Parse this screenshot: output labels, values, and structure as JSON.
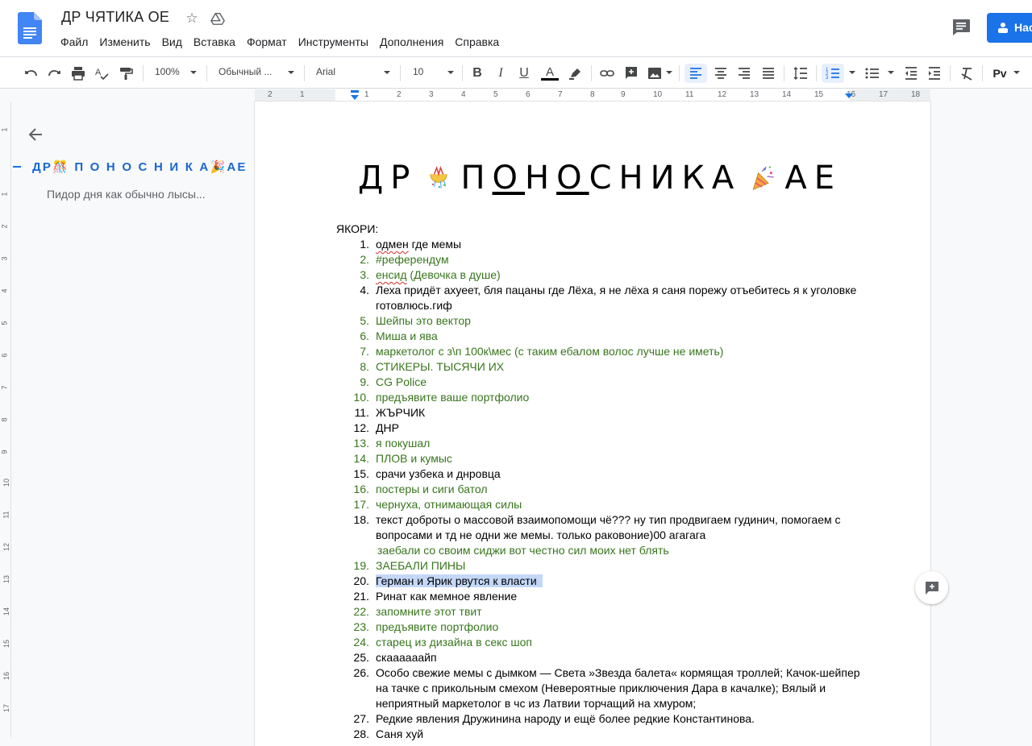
{
  "app": {
    "title": "ДР ЧЯТИКА ОЕ",
    "share_label": "Нас",
    "menu": [
      "Файл",
      "Изменить",
      "Вид",
      "Вставка",
      "Формат",
      "Инструменты",
      "Дополнения",
      "Справка"
    ]
  },
  "toolbar": {
    "zoom": "100%",
    "style": "Обычный ...",
    "font": "Arial",
    "size": "10",
    "input_tools": "Pv"
  },
  "ruler": {
    "labels": [
      "2",
      "1",
      "1",
      "2",
      "3",
      "4",
      "5",
      "6",
      "7",
      "8",
      "9",
      "10",
      "11",
      "12",
      "13",
      "14",
      "15",
      "16",
      "17",
      "18"
    ],
    "vlabels": [
      "1",
      "1",
      "2",
      "3",
      "4",
      "5",
      "6",
      "7",
      "8",
      "9",
      "10",
      "11",
      "12",
      "13",
      "14",
      "15",
      "16",
      "17"
    ]
  },
  "outline": {
    "heading": "ДР🎊 П О Н О С Н И К А🎉АЕ",
    "sub": "Пидор дня как обычно лысы..."
  },
  "document": {
    "heading_parts": [
      "ДР",
      "П",
      "О",
      "Н",
      "О",
      "С",
      "Н",
      "И",
      "К",
      "А",
      "АЕ"
    ],
    "anchors_label": "ЯКОРИ:",
    "items": [
      {
        "n": "1.",
        "text": "одмен где мемы",
        "color": "black",
        "sq": "одмен"
      },
      {
        "n": "2.",
        "text": "#референдум",
        "color": "green"
      },
      {
        "n": "3.",
        "text": "енсид (Девочка в душе)",
        "color": "green",
        "sq": "енсид"
      },
      {
        "n": "4.",
        "text": "Леха придёт ахуеет, бля пацаны где Лёха, я не лёха я саня порежу отъебитесь я к уголовке готовлюсь.гиф",
        "color": "black"
      },
      {
        "n": "5.",
        "text": "Шейпы это вектор",
        "color": "green"
      },
      {
        "n": "6.",
        "text": "Миша и ява",
        "color": "green"
      },
      {
        "n": "7.",
        "text": "маркетолог с з\\п 100к\\мес (с таким ебалом волос лучше не иметь)",
        "color": "green"
      },
      {
        "n": "8.",
        "text": "СТИКЕРЫ. ТЫСЯЧИ ИХ",
        "color": "green"
      },
      {
        "n": "9.",
        "text": "CG Police",
        "color": "green"
      },
      {
        "n": "10.",
        "text": "предъявите ваше портфолио",
        "color": "green"
      },
      {
        "n": "11.",
        "text": "ЖЪРЧИК",
        "color": "black"
      },
      {
        "n": "12.",
        "text": "ДНР",
        "color": "black"
      },
      {
        "n": "13.",
        "text": "я покушал",
        "color": "green"
      },
      {
        "n": "14.",
        "text": "ПЛОВ и кумыс",
        "color": "green"
      },
      {
        "n": "15.",
        "text": "срачи узбека и днровца",
        "color": "black"
      },
      {
        "n": "16.",
        "text": "постеры и сиги батол",
        "color": "green"
      },
      {
        "n": "17.",
        "text": "чернуха, отнимающая силы",
        "color": "green"
      },
      {
        "n": "18.",
        "text": "текст доброты о массовой взаимопомощи чё??? ну тип продвигаем гудинич, помогаем с вопросами и тд не одни же мемы. только раковоние)00 агагага",
        "color": "black"
      },
      {
        "n": "",
        "text": "заебали со своим сиджи вот честно сил моих нет блять",
        "color": "green",
        "continuation": true
      },
      {
        "n": "19.",
        "text": "ЗАЕБАЛИ ПИНЫ",
        "color": "green"
      },
      {
        "n": "20.",
        "text": "Герман и Ярик рвутся к власти",
        "color": "black",
        "highlight": true
      },
      {
        "n": "21.",
        "text": "Ринат как мемное явление",
        "color": "black"
      },
      {
        "n": "22.",
        "text": "запомните этот твит",
        "color": "green"
      },
      {
        "n": "23.",
        "text": "предъявите портфолио",
        "color": "green"
      },
      {
        "n": "24.",
        "text": "старец из дизайна в секс шоп",
        "color": "green"
      },
      {
        "n": "25.",
        "text": "скаааааайп",
        "color": "black"
      },
      {
        "n": "26.",
        "text": "Особо свежие мемы с дымком — Света »Звезда балета« кормящая троллей; Качок-шейпер на тачке с прикольным смехом (Невероятные приключения Дара в качалке); Вялый и неприятный маркетолог в чс из Латвии торчащий на хмуром;",
        "color": "black"
      },
      {
        "n": "27.",
        "text": "Редкие явления Дружинина народу и ещё более редкие Константинова.",
        "color": "black"
      },
      {
        "n": "28.",
        "text": "Саня хуй",
        "color": "black"
      }
    ]
  },
  "colors": {
    "accent": "#1a73e8",
    "green_text": "#38761d",
    "highlight": "#c3d7f7",
    "outline_heading": "#1967d2"
  }
}
